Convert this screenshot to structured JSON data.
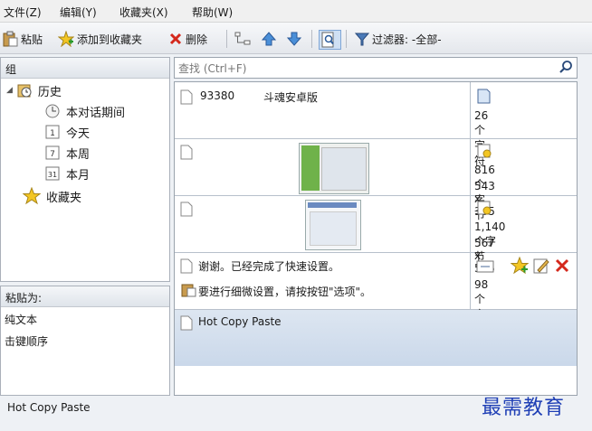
{
  "menu": [
    "文件(Z)",
    "编辑(Y)",
    "收藏夹(X)",
    "帮助(W)"
  ],
  "toolbar": {
    "paste": "粘贴",
    "add_fav": "添加到收藏夹",
    "delete": "删除",
    "filter_label": "过滤器: -全部-"
  },
  "group": {
    "header": "组",
    "history": "历史",
    "this_session": "本对话期间",
    "today": "今天",
    "this_week": "本周",
    "this_month": "本月",
    "favorites": "收藏夹",
    "today_num": "1",
    "week_num": "7",
    "month_num": "31"
  },
  "paste_as": {
    "header": "粘贴为:",
    "options": [
      "纯文本",
      "击键顺序"
    ]
  },
  "search": {
    "placeholder": "查找 (Ctrl+F)"
  },
  "clips": [
    {
      "text_left": "93380",
      "text_right": "斗魂安卓版",
      "info1": "26 个字符"
    },
    {
      "info1": "816 个字节",
      "info2": "543 x 385"
    },
    {
      "info1": "1,140 个字节",
      "info2": "567 x 515"
    },
    {
      "line1": "谢谢。已经完成了快速设置。",
      "line2": "要进行细微设置，请按按钮\"选项\"。",
      "info1": "98 个字符"
    },
    {
      "text": "Hot Copy Paste"
    }
  ],
  "status": {
    "text": "Hot Copy Paste"
  },
  "watermark": "最需教育"
}
